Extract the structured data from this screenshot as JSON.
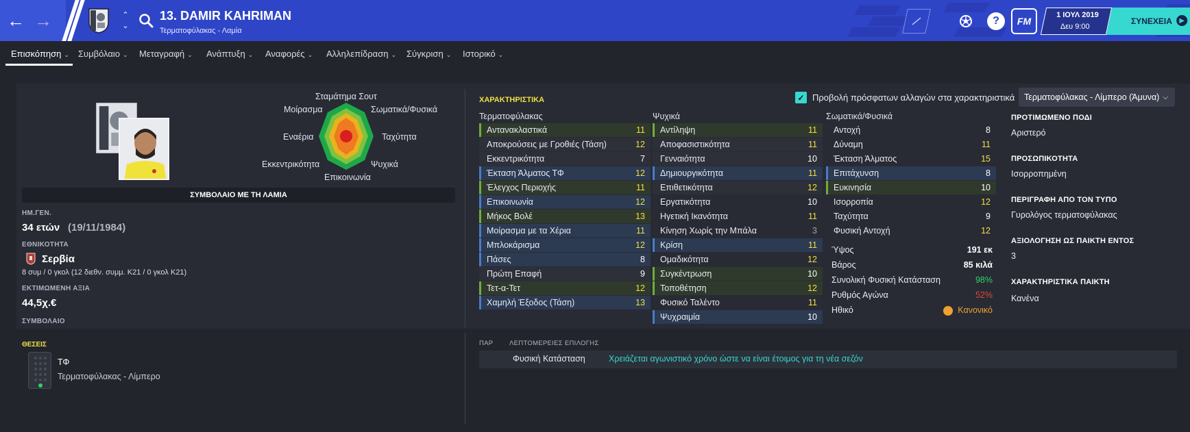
{
  "header": {
    "player_name": "13. DAMIR KAHRIMAN",
    "player_subtitle": "Τερματοφύλακας - Λαμία",
    "date": "1 ΙΟΥΛ 2019",
    "day_time": "Δευ 9:00",
    "continue_label": "ΣΥΝΕΧΕΙΑ",
    "fm_logo": "FM",
    "help_icon": "?",
    "back_icon": "arrow-left-icon",
    "forward_icon": "arrow-right-icon"
  },
  "tabs": [
    {
      "label": "Επισκόπηση"
    },
    {
      "label": "Συμβόλαιο"
    },
    {
      "label": "Μεταγραφή"
    },
    {
      "label": "Ανάπτυξη"
    },
    {
      "label": "Αναφορές"
    },
    {
      "label": "Αλληλεπίδραση"
    },
    {
      "label": "Σύγκριση"
    },
    {
      "label": "Ιστορικό"
    }
  ],
  "profile": {
    "contract_bar": "ΣΥΜΒΟΛΑΙΟ ΜΕ ΤΗ ΛΑΜΙΑ",
    "dob_label": "ΗΜ.ΓΕΝ.",
    "age": "34 ετών",
    "dob": "(19/11/1984)",
    "nationality_label": "ΕΘΝΙΚΟΤΗΤΑ",
    "nationality": "Σερβία",
    "caps": "8 συμ / 0 γκολ (12 διεθν. συμμ. Κ21 / 0 γκολ Κ21)",
    "value_label": "ΕΚΤΙΜΩΜΕΝΗ ΑΞΙΑ",
    "value": "44,5χ.€",
    "contract_label": "ΣΥΜΒΟΛΑΙΟ"
  },
  "radar": {
    "labels": {
      "top": "Σταμάτημα Σουτ",
      "top_left": "Μοίρασμα",
      "top_right": "Σωματικά/Φυσικά",
      "left": "Εναέρια",
      "right": "Ταχύτητα",
      "bottom_left": "Εκκεντρικότητα",
      "bottom_right": "Ψυχικά",
      "bottom": "Επικοινωνία"
    }
  },
  "attributes": {
    "heading": "ΧΑΡΑΚΤΗΡΙΣΤΙΚΑ",
    "show_changes_label": "Προβολή πρόσφατων αλλαγών στα χαρακτηριστικά",
    "role_select": "Τερματοφύλακας - Λίμπερο (Άμυνα)",
    "goalkeeping": {
      "title": "Τερματοφύλακας",
      "rows": [
        {
          "name": "Αντανακλαστικά",
          "value": "11"
        },
        {
          "name": "Αποκρούσεις με Γροθιές (Τάση)",
          "value": "12"
        },
        {
          "name": "Εκκεντρικότητα",
          "value": "7"
        },
        {
          "name": "Έκταση Άλματος ΤΦ",
          "value": "12"
        },
        {
          "name": "Έλεγχος Περιοχής",
          "value": "11"
        },
        {
          "name": "Επικοινωνία",
          "value": "12"
        },
        {
          "name": "Μήκος Βολέ",
          "value": "13"
        },
        {
          "name": "Μοίρασμα με τα Χέρια",
          "value": "11"
        },
        {
          "name": "Μπλοκάρισμα",
          "value": "12"
        },
        {
          "name": "Πάσες",
          "value": "8"
        },
        {
          "name": "Πρώτη Επαφή",
          "value": "9"
        },
        {
          "name": "Τετ-α-Τετ",
          "value": "12"
        },
        {
          "name": "Χαμηλή Έξοδος (Τάση)",
          "value": "13"
        }
      ]
    },
    "mental": {
      "title": "Ψυχικά",
      "rows": [
        {
          "name": "Αντίληψη",
          "value": "11"
        },
        {
          "name": "Αποφασιστικότητα",
          "value": "11"
        },
        {
          "name": "Γενναιότητα",
          "value": "10"
        },
        {
          "name": "Δημιουργικότητα",
          "value": "11"
        },
        {
          "name": "Επιθετικότητα",
          "value": "12"
        },
        {
          "name": "Εργατικότητα",
          "value": "10"
        },
        {
          "name": "Ηγετική Ικανότητα",
          "value": "11"
        },
        {
          "name": "Κίνηση Χωρίς την Μπάλα",
          "value": "3"
        },
        {
          "name": "Κρίση",
          "value": "11"
        },
        {
          "name": "Ομαδικότητα",
          "value": "12"
        },
        {
          "name": "Συγκέντρωση",
          "value": "10"
        },
        {
          "name": "Τοποθέτηση",
          "value": "12"
        },
        {
          "name": "Φυσικό Ταλέντο",
          "value": "11"
        },
        {
          "name": "Ψυχραιμία",
          "value": "10"
        }
      ]
    },
    "physical": {
      "title": "Σωματικά/Φυσικά",
      "rows": [
        {
          "name": "Αντοχή",
          "value": "8"
        },
        {
          "name": "Δύναμη",
          "value": "11"
        },
        {
          "name": "Έκταση Άλματος",
          "value": "15"
        },
        {
          "name": "Επιτάχυνση",
          "value": "8"
        },
        {
          "name": "Ευκινησία",
          "value": "10"
        },
        {
          "name": "Ισορροπία",
          "value": "12"
        },
        {
          "name": "Ταχύτητα",
          "value": "9"
        },
        {
          "name": "Φυσική Αντοχή",
          "value": "12"
        }
      ]
    },
    "meta": [
      {
        "name": "Ύψος",
        "value": "191 εκ"
      },
      {
        "name": "Βάρος",
        "value": "85 κιλά"
      },
      {
        "name": "Συνολική Φυσική Κατάσταση",
        "value": "98%"
      },
      {
        "name": "Ρυθμός Αγώνα",
        "value": "52%"
      },
      {
        "name": "Ηθικό",
        "value": "Κανονικό"
      }
    ]
  },
  "info": [
    {
      "label": "ΠΡΟΤΙΜΩΜΕΝΟ ΠΟΔΙ",
      "value": "Αριστερό"
    },
    {
      "label": "ΠΡΟΣΩΠΙΚΟΤΗΤΑ",
      "value": "Ισορροπημένη"
    },
    {
      "label": "ΠΕΡΙΓΡΑΦΗ ΑΠΟ ΤΟΝ ΤΥΠΟ",
      "value": "Γυρολόγος τερματοφύλακας"
    },
    {
      "label": "ΑΞΙΟΛΟΓΗΣΗ ΩΣ ΠΑΙΚΤΗ ΕΝΤΟΣ",
      "value": "3"
    },
    {
      "label": "ΧΑΡΑΚΤΗΡΙΣΤΙΚΑ ΠΑΙΚΤΗ",
      "value": "Κανένα"
    }
  ],
  "positions": {
    "heading": "ΘΕΣΕΙΣ",
    "code": "ΤΦ",
    "description": "Τερματοφύλακας - Λίμπερο"
  },
  "selection": {
    "col1": "ΠΑΡ",
    "col2": "ΛΕΠΤΟΜΕΡΕΙΕΣ ΕΠΙΛΟΓΗΣ",
    "name": "Φυσική Κατάσταση",
    "detail": "Χρειάζεται αγωνιστικό χρόνο ώστε να είναι έτοιμος για τη νέα σεζόν"
  },
  "colors": {
    "topbar": "#2f45c8",
    "accent": "#37d8d0",
    "highlight": "#f0e040",
    "good": "#2ad36a",
    "bad": "#e0453a"
  }
}
